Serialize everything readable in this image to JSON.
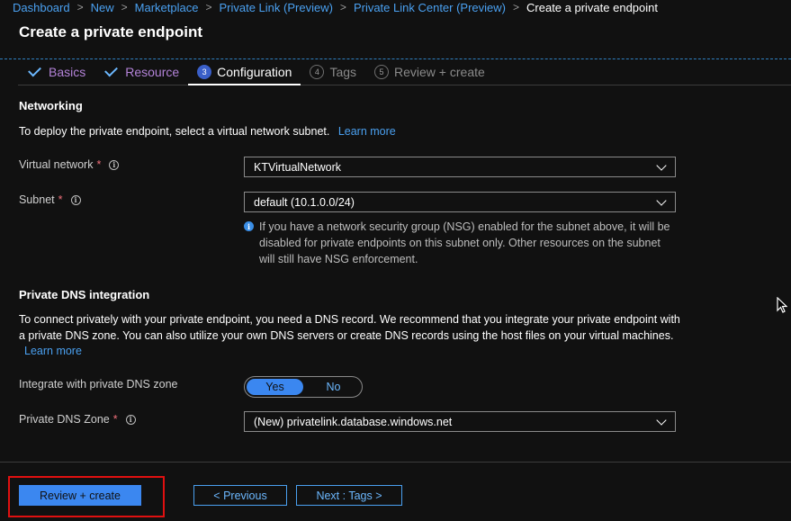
{
  "breadcrumb": {
    "items": [
      "Dashboard",
      "New",
      "Marketplace",
      "Private Link (Preview)",
      "Private Link Center (Preview)"
    ],
    "current": "Create a private endpoint"
  },
  "page_title": "Create a private endpoint",
  "tabs": [
    {
      "label": "Basics",
      "state": "done"
    },
    {
      "label": "Resource",
      "state": "done"
    },
    {
      "number": "3",
      "label": "Configuration",
      "state": "active"
    },
    {
      "number": "4",
      "label": "Tags",
      "state": "pending"
    },
    {
      "number": "5",
      "label": "Review + create",
      "state": "pending"
    }
  ],
  "networking": {
    "heading": "Networking",
    "description": "To deploy the private endpoint, select a virtual network subnet.",
    "learn_more": "Learn more",
    "virtual_network": {
      "label": "Virtual network",
      "required": "*",
      "value": "KTVirtualNetwork"
    },
    "subnet": {
      "label": "Subnet",
      "required": "*",
      "value": "default (10.1.0.0/24)"
    },
    "nsg_note": "If you have a network security group (NSG) enabled for the subnet above, it will be disabled for private endpoints on this subnet only. Other resources on the subnet will still have NSG enforcement."
  },
  "dns": {
    "heading": "Private DNS integration",
    "description": "To connect privately with your private endpoint, you need a DNS record. We recommend that you integrate your private endpoint with a private DNS zone. You can also utilize your own DNS servers or create DNS records using the host files on your virtual machines.",
    "learn_more": "Learn more",
    "integrate": {
      "label": "Integrate with private DNS zone",
      "yes": "Yes",
      "no": "No",
      "selected": "Yes"
    },
    "zone": {
      "label": "Private DNS Zone",
      "required": "*",
      "value": "(New) privatelink.database.windows.net"
    }
  },
  "footer": {
    "review_create": "Review + create",
    "previous": "< Previous",
    "next": "Next : Tags >"
  },
  "colors": {
    "accent": "#3b87f0",
    "link": "#4aa0f0",
    "background": "#111111",
    "required": "#f1707b",
    "highlight": "#e01010",
    "completed_tab": "#b383d8"
  }
}
